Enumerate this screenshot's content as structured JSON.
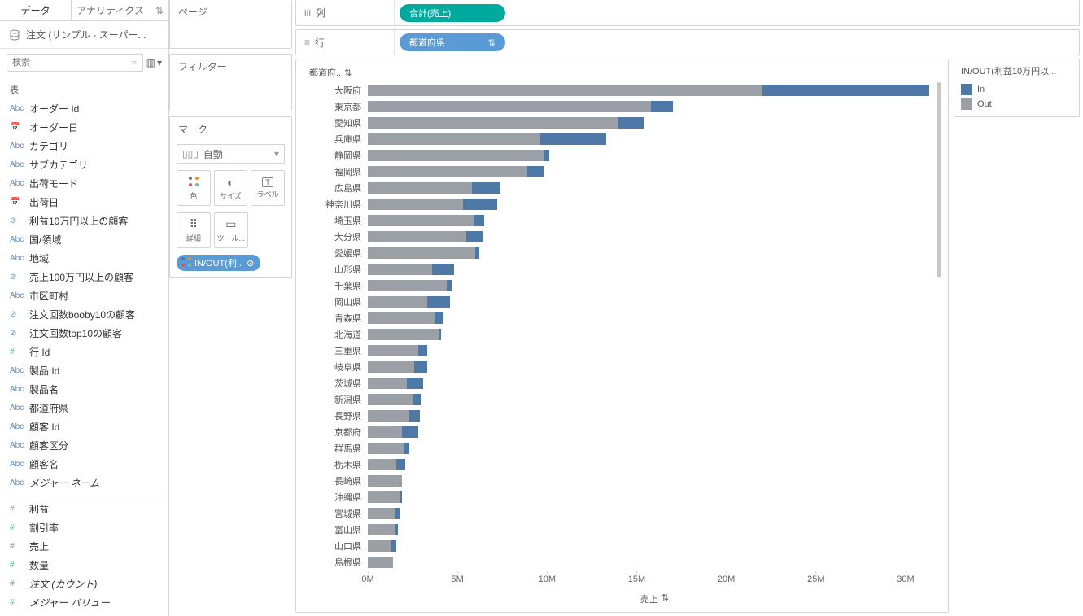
{
  "tabs": {
    "data": "データ",
    "analytics": "アナリティクス"
  },
  "datasource": "注文 (サンプル - スーパー...",
  "search": {
    "placeholder": "検索"
  },
  "schema": {
    "header": "表",
    "dims": [
      {
        "icon": "Abc",
        "label": "オーダー Id"
      },
      {
        "icon": "date",
        "label": "オーダー日"
      },
      {
        "icon": "Abc",
        "label": "カテゴリ"
      },
      {
        "icon": "Abc",
        "label": "サブカテゴリ"
      },
      {
        "icon": "Abc",
        "label": "出荷モード"
      },
      {
        "icon": "date",
        "label": "出荷日"
      },
      {
        "icon": "set",
        "label": "利益10万円以上の顧客"
      },
      {
        "icon": "Abc",
        "label": "国/領域"
      },
      {
        "icon": "Abc",
        "label": "地域"
      },
      {
        "icon": "set",
        "label": "売上100万円以上の顧客"
      },
      {
        "icon": "Abc",
        "label": "市区町村"
      },
      {
        "icon": "set",
        "label": "注文回数booby10の顧客"
      },
      {
        "icon": "set",
        "label": "注文回数top10の顧客"
      },
      {
        "icon": "num",
        "label": "行 Id"
      },
      {
        "icon": "Abc",
        "label": "製品 Id"
      },
      {
        "icon": "Abc",
        "label": "製品名"
      },
      {
        "icon": "Abc",
        "label": "都道府県"
      },
      {
        "icon": "Abc",
        "label": "顧客 Id"
      },
      {
        "icon": "Abc",
        "label": "顧客区分"
      },
      {
        "icon": "Abc",
        "label": "顧客名"
      },
      {
        "icon": "Abc",
        "label": "メジャー ネーム",
        "italic": true
      }
    ],
    "meas": [
      {
        "icon": "num",
        "label": "利益"
      },
      {
        "icon": "num",
        "label": "割引率"
      },
      {
        "icon": "num",
        "label": "売上"
      },
      {
        "icon": "num",
        "label": "数量"
      },
      {
        "icon": "num",
        "label": "注文 (カウント)",
        "italic": true
      },
      {
        "icon": "num",
        "label": "メジャー バリュー",
        "italic": true
      }
    ]
  },
  "cards": {
    "pages": "ページ",
    "filters": "フィルター",
    "marks": "マーク",
    "mark_type": "自動",
    "color": "色",
    "size": "サイズ",
    "label": "ラベル",
    "detail": "詳細",
    "tooltip": "ツール...",
    "color_pill": "IN/OUT(利.."
  },
  "shelves": {
    "columns": "列",
    "rows": "行",
    "col_pill": "合計(売上)",
    "row_pill": "都道府県"
  },
  "viz": {
    "header": "都道府..",
    "xlabel": "売上"
  },
  "legend": {
    "title": "IN/OUT(利益10万円以...",
    "in": "In",
    "out": "Out"
  },
  "chart_data": {
    "type": "bar",
    "xlabel": "売上",
    "xlim": [
      0,
      32000000
    ],
    "ticks": [
      0,
      5000000,
      10000000,
      15000000,
      20000000,
      25000000,
      30000000
    ],
    "tick_labels": [
      "0M",
      "5M",
      "10M",
      "15M",
      "20M",
      "25M",
      "30M"
    ],
    "legend": [
      "In",
      "Out"
    ],
    "series": [
      {
        "name": "大阪府",
        "out": 22000000,
        "in": 9300000
      },
      {
        "name": "東京都",
        "out": 15800000,
        "in": 1200000
      },
      {
        "name": "愛知県",
        "out": 14000000,
        "in": 1400000
      },
      {
        "name": "兵庫県",
        "out": 9600000,
        "in": 3700000
      },
      {
        "name": "静岡県",
        "out": 9800000,
        "in": 300000
      },
      {
        "name": "福岡県",
        "out": 8900000,
        "in": 900000
      },
      {
        "name": "広島県",
        "out": 5800000,
        "in": 1600000
      },
      {
        "name": "神奈川県",
        "out": 5300000,
        "in": 1900000
      },
      {
        "name": "埼玉県",
        "out": 5900000,
        "in": 600000
      },
      {
        "name": "大分県",
        "out": 5500000,
        "in": 900000
      },
      {
        "name": "愛媛県",
        "out": 6000000,
        "in": 200000
      },
      {
        "name": "山形県",
        "out": 3600000,
        "in": 1200000
      },
      {
        "name": "千葉県",
        "out": 4400000,
        "in": 300000
      },
      {
        "name": "岡山県",
        "out": 3300000,
        "in": 1300000
      },
      {
        "name": "青森県",
        "out": 3700000,
        "in": 500000
      },
      {
        "name": "北海道",
        "out": 4000000,
        "in": 100000
      },
      {
        "name": "三重県",
        "out": 2800000,
        "in": 500000
      },
      {
        "name": "岐阜県",
        "out": 2600000,
        "in": 700000
      },
      {
        "name": "茨城県",
        "out": 2200000,
        "in": 900000
      },
      {
        "name": "新潟県",
        "out": 2500000,
        "in": 500000
      },
      {
        "name": "長野県",
        "out": 2300000,
        "in": 600000
      },
      {
        "name": "京都府",
        "out": 1900000,
        "in": 900000
      },
      {
        "name": "群馬県",
        "out": 2000000,
        "in": 300000
      },
      {
        "name": "栃木県",
        "out": 1600000,
        "in": 500000
      },
      {
        "name": "長崎県",
        "out": 1900000,
        "in": 0
      },
      {
        "name": "沖縄県",
        "out": 1800000,
        "in": 100000
      },
      {
        "name": "宮城県",
        "out": 1500000,
        "in": 300000
      },
      {
        "name": "富山県",
        "out": 1500000,
        "in": 200000
      },
      {
        "name": "山口県",
        "out": 1300000,
        "in": 300000
      },
      {
        "name": "島根県",
        "out": 1400000,
        "in": 0
      }
    ]
  }
}
